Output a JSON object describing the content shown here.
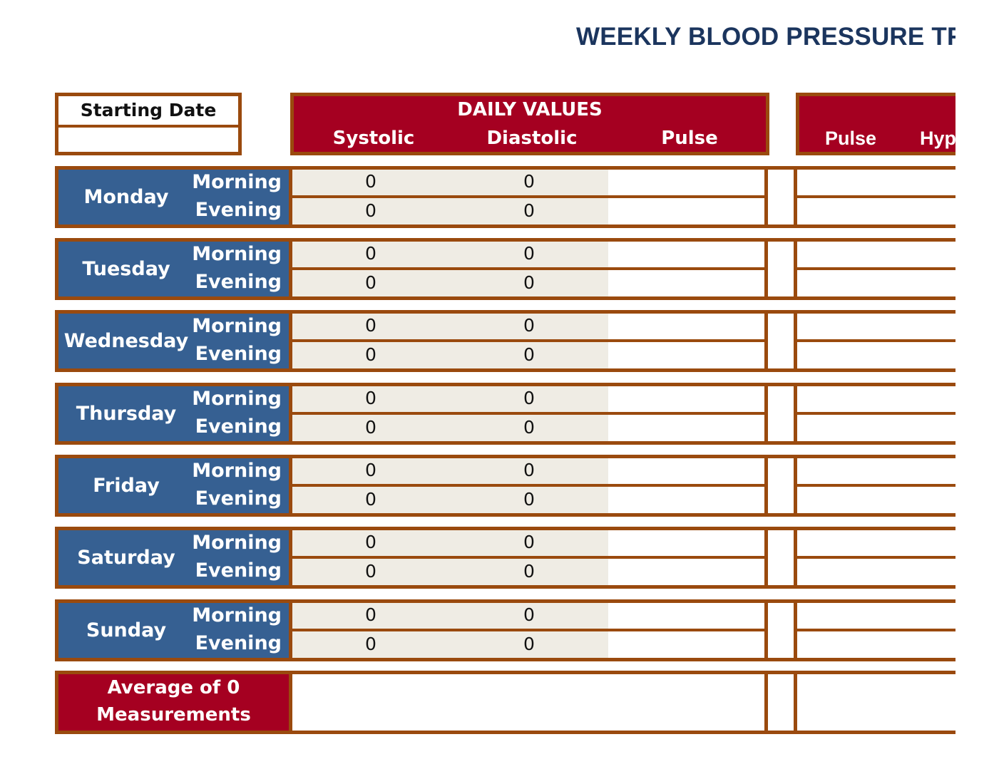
{
  "title": "WEEKLY BLOOD PRESSURE TR",
  "starting_date": {
    "label": "Starting Date",
    "value": ""
  },
  "daily_values": {
    "title": "DAILY VALUES",
    "columns": [
      "Systolic",
      "Diastolic",
      "Pulse"
    ]
  },
  "right_header": {
    "columns": [
      "Pulse",
      "Hyp"
    ]
  },
  "colors": {
    "header_red": "#a50021",
    "day_blue": "#366092",
    "border_brown": "#9a4a0e",
    "cell_grey": "#efece4",
    "title_navy": "#1b355e"
  },
  "days": [
    {
      "name": "Monday",
      "morning": "Morning",
      "evening": "Evening",
      "readings": {
        "morning": {
          "systolic": "0",
          "diastolic": "0",
          "pulse": ""
        },
        "evening": {
          "systolic": "0",
          "diastolic": "0",
          "pulse": ""
        }
      }
    },
    {
      "name": "Tuesday",
      "morning": "Morning",
      "evening": "Evening",
      "readings": {
        "morning": {
          "systolic": "0",
          "diastolic": "0",
          "pulse": ""
        },
        "evening": {
          "systolic": "0",
          "diastolic": "0",
          "pulse": ""
        }
      }
    },
    {
      "name": "Wednesday",
      "morning": "Morning",
      "evening": "Evening",
      "readings": {
        "morning": {
          "systolic": "0",
          "diastolic": "0",
          "pulse": ""
        },
        "evening": {
          "systolic": "0",
          "diastolic": "0",
          "pulse": ""
        }
      }
    },
    {
      "name": "Thursday",
      "morning": "Morning",
      "evening": "Evening",
      "readings": {
        "morning": {
          "systolic": "0",
          "diastolic": "0",
          "pulse": ""
        },
        "evening": {
          "systolic": "0",
          "diastolic": "0",
          "pulse": ""
        }
      }
    },
    {
      "name": "Friday",
      "morning": "Morning",
      "evening": "Evening",
      "readings": {
        "morning": {
          "systolic": "0",
          "diastolic": "0",
          "pulse": ""
        },
        "evening": {
          "systolic": "0",
          "diastolic": "0",
          "pulse": ""
        }
      }
    },
    {
      "name": "Saturday",
      "morning": "Morning",
      "evening": "Evening",
      "readings": {
        "morning": {
          "systolic": "0",
          "diastolic": "0",
          "pulse": ""
        },
        "evening": {
          "systolic": "0",
          "diastolic": "0",
          "pulse": ""
        }
      }
    },
    {
      "name": "Sunday",
      "morning": "Morning",
      "evening": "Evening",
      "readings": {
        "morning": {
          "systolic": "0",
          "diastolic": "0",
          "pulse": ""
        },
        "evening": {
          "systolic": "0",
          "diastolic": "0",
          "pulse": ""
        }
      }
    }
  ],
  "average": {
    "line1": "Average of 0",
    "line2": "Measurements"
  }
}
